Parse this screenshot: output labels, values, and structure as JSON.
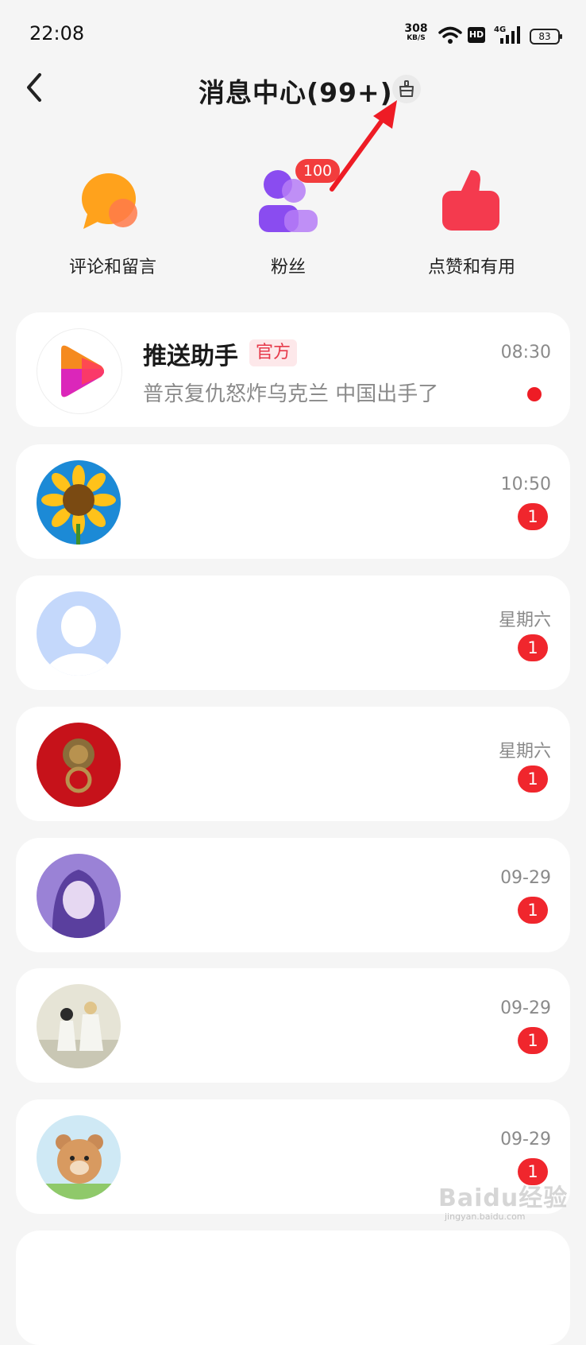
{
  "status": {
    "time": "22:08",
    "net_speed_value": "308",
    "net_speed_unit": "KB/S",
    "hd": "HD",
    "net_type": "4G",
    "battery": "83"
  },
  "header": {
    "title": "消息中心(99+)"
  },
  "categories": [
    {
      "label": "评论和留言",
      "icon": "comment-bubble-icon"
    },
    {
      "label": "粉丝",
      "icon": "fans-icon",
      "badge": "100"
    },
    {
      "label": "点赞和有用",
      "icon": "thumbs-up-icon"
    }
  ],
  "messages": [
    {
      "name": "推送助手",
      "tag": "官方",
      "preview": "普京复仇怒炸乌克兰 中国出手了",
      "time": "08:30",
      "unread_dot": true
    },
    {
      "time": "10:50",
      "unread": "1",
      "avatar": "sunflower"
    },
    {
      "time": "星期六",
      "unread": "1",
      "avatar": "default-person"
    },
    {
      "time": "星期六",
      "unread": "1",
      "avatar": "door-knocker"
    },
    {
      "time": "09-29",
      "unread": "1",
      "avatar": "anime-girl"
    },
    {
      "time": "09-29",
      "unread": "1",
      "avatar": "couple-illustration"
    },
    {
      "time": "09-29",
      "unread": "1",
      "avatar": "bear-cartoon"
    }
  ],
  "watermark": {
    "text": "Baidu经验",
    "url": "jingyan.baidu.com"
  },
  "colors": {
    "accent_red": "#f0262d",
    "background": "#f5f5f5",
    "card": "#ffffff"
  }
}
